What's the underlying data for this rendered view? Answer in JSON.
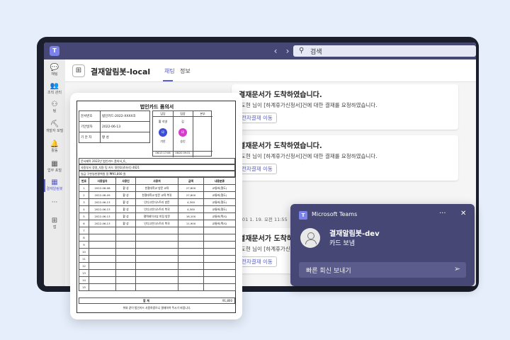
{
  "topbar": {
    "search_placeholder": "검색",
    "back_icon": "chevron-left-icon",
    "forward_icon": "chevron-right-icon"
  },
  "rail": {
    "items": [
      {
        "label": "채팅",
        "icon": "💬"
      },
      {
        "label": "조직 관리",
        "icon": "👥"
      },
      {
        "label": "팀",
        "icon": "⚇"
      },
      {
        "label": "개발자 포털",
        "icon": "⛏"
      },
      {
        "label": "활동",
        "icon": "🔔"
      },
      {
        "label": "업무 포털",
        "icon": "▦"
      },
      {
        "label": "결재알림봇",
        "icon": "▦"
      },
      {
        "label": "···",
        "icon": ""
      },
      {
        "label": "앱",
        "icon": "⊞"
      }
    ]
  },
  "header": {
    "title": "결재알림봇-local",
    "tab_chat": "채팅",
    "tab_info": "정보"
  },
  "cards": [
    {
      "title": "결재문서가 도착하였습니다.",
      "body": "[도현 님이 [하계휴가신청서]건에 대한 결재를 요청하였습니다.",
      "button": "전자결재 이동"
    },
    {
      "title": "결재문서가 도착하였습니다.",
      "body": "[도현 님이 [하계휴가신청서]건에 대한 결재를 요청하였습니다.",
      "button": "전자결재 이동"
    },
    {
      "title": "결재문서가 도착하였습니다.",
      "body": "[도현 님이 [하계휴가신청서]건에 대한 결재를 요청하였습니다.",
      "button": "전자결재 이동"
    }
  ],
  "message_meta": "est01 1. 19. 오전 11:55",
  "doc": {
    "title": "법인카드 품의서",
    "meta": [
      {
        "label": "문서번호",
        "value": "법인카드-2022-XXXX호"
      },
      {
        "label": "기안일자",
        "value": "2022-06-13"
      },
      {
        "label": "기 안 자",
        "value": "황 성"
      }
    ],
    "approval_heads": [
      "담당",
      "팀장",
      "본부"
    ],
    "approvers": [
      {
        "name": "황 석영",
        "label": "기안",
        "date": "06/13 17:06"
      },
      {
        "name": "김",
        "label": "승인",
        "date": "06/20 09:31"
      },
      {
        "name": "",
        "label": "",
        "date": ""
      }
    ],
    "subject": "문서제목  2022년 법인카드 품의서_6_",
    "card_user": "사용부서  경영_지원 팀     카드 뒷번호(4자리)  4621",
    "summary": "일금 구천일천팔백원 정        ₩91,800 원",
    "columns": [
      "번호",
      "사용일자",
      "사용인",
      "사용처",
      "금액",
      "내용분류"
    ],
    "rows": [
      [
        "1",
        "2022-06-08",
        "황 성",
        "한결대학교 방문 교육",
        "27,600",
        "교통비(철도)"
      ],
      [
        "2",
        "2022-06-09",
        "황 성",
        "한결대학교 방문 교육 복귀",
        "27,600",
        "교통비(철도)"
      ],
      [
        "3",
        "2022-06-13",
        "황 성",
        "인디고인더스트리 방문",
        "4,300",
        "교통비(철도)"
      ],
      [
        "4",
        "2022-06-13",
        "황 성",
        "인디고인더스트리 복귀",
        "4,300",
        "교통비(철도)"
      ],
      [
        "5",
        "2022-06-13",
        "황 성",
        "평택레이크뷰 미팅 방문",
        "16,100",
        "교통비(택시)"
      ],
      [
        "6",
        "2022-06-13",
        "황 성",
        "인디고인더스트리 복귀",
        "11,900",
        "교통비(택시)"
      ],
      [
        "7",
        "",
        "",
        "",
        "",
        ""
      ],
      [
        "8",
        "",
        "",
        "",
        "",
        ""
      ],
      [
        "9",
        "",
        "",
        "",
        "",
        ""
      ],
      [
        "10",
        "",
        "",
        "",
        "",
        ""
      ],
      [
        "11",
        "",
        "",
        "",
        "",
        ""
      ],
      [
        "12",
        "",
        "",
        "",
        "",
        ""
      ],
      [
        "13",
        "",
        "",
        "",
        "",
        ""
      ],
      [
        "14",
        "",
        "",
        "",
        "",
        ""
      ],
      [
        "15",
        "",
        "",
        "",
        "",
        ""
      ]
    ],
    "total_label": "합 계",
    "total_value": "91,800",
    "footer": "위와 같이 법인카드 사용하였으니 결재하여 주시기 바랍니다."
  },
  "toast": {
    "app_name": "Microsoft Teams",
    "sender": "결재알림봇-dev",
    "message": "카드 보냄",
    "reply_placeholder": "빠른 회신 보내기"
  }
}
